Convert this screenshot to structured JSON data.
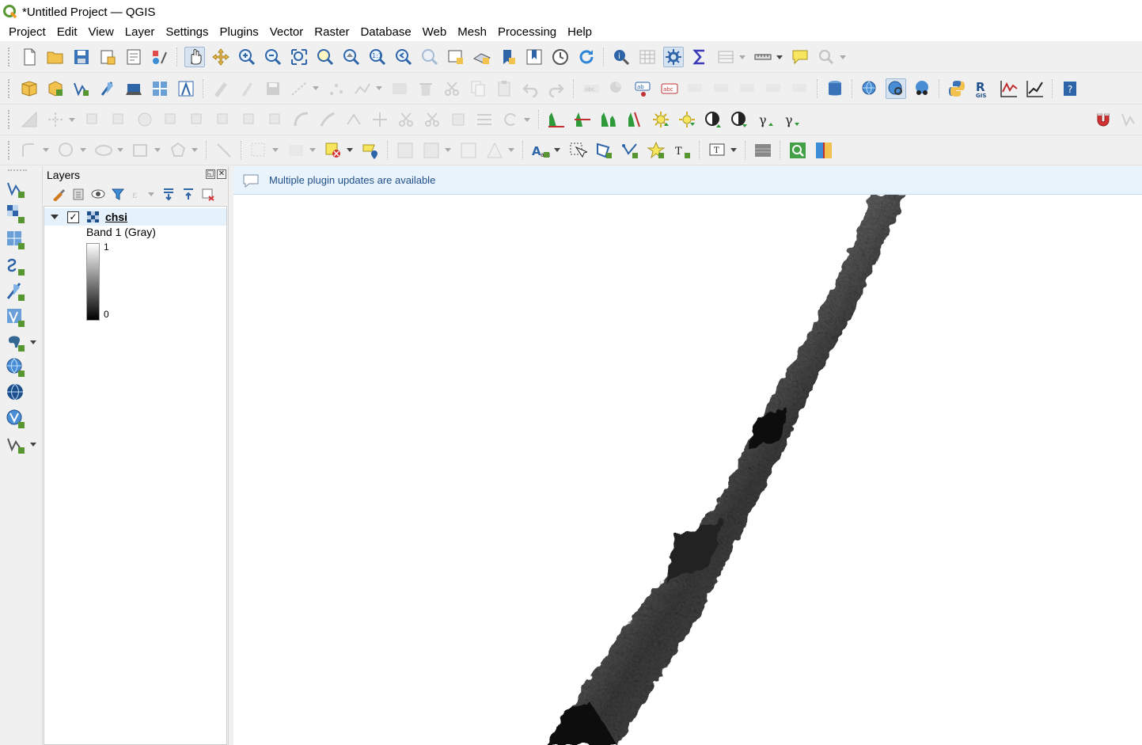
{
  "window": {
    "title": "*Untitled Project — QGIS"
  },
  "menu": [
    "Project",
    "Edit",
    "View",
    "Layer",
    "Settings",
    "Plugins",
    "Vector",
    "Raster",
    "Database",
    "Web",
    "Mesh",
    "Processing",
    "Help"
  ],
  "layers_panel": {
    "title": "Layers",
    "layer": {
      "name": "chsi",
      "checked": "✓",
      "band": "Band 1 (Gray)",
      "ramp_max": "1",
      "ramp_min": "0"
    }
  },
  "message_bar": {
    "text": "Multiple plugin updates are available"
  },
  "colors": {
    "accent": "#1f4f8a",
    "selection": "#e5f1fb",
    "msg_bg": "#e9f3fc"
  }
}
